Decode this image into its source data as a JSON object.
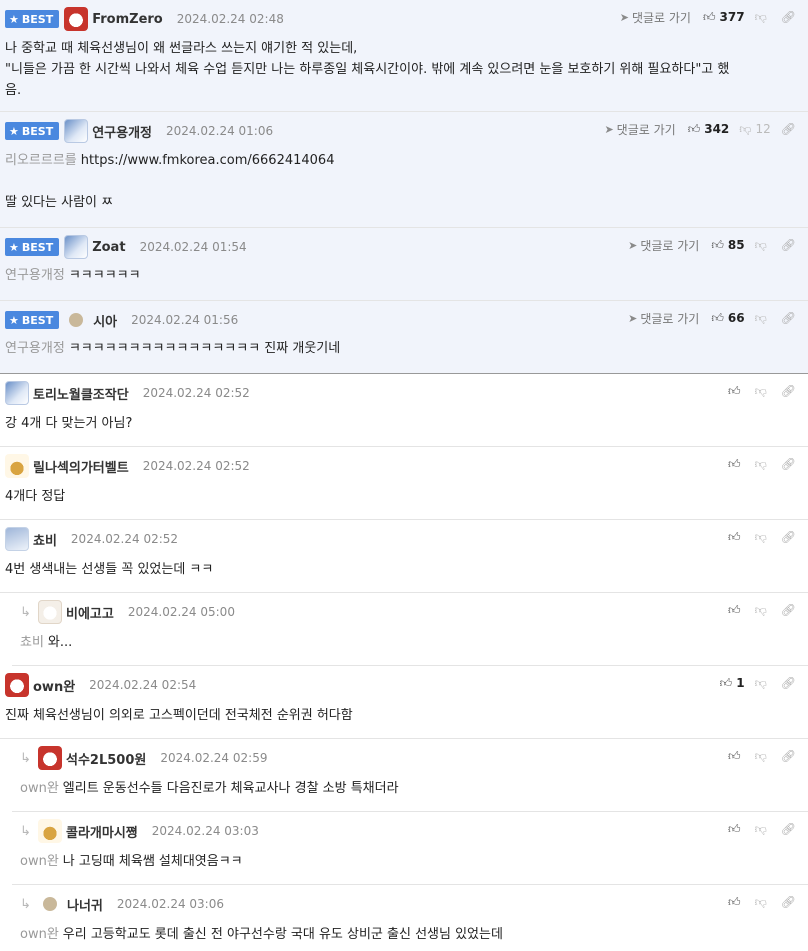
{
  "labels": {
    "best": "BEST",
    "reply_to": "댓글로 가기"
  },
  "comments": [
    {
      "nick": "FromZero",
      "date": "2024.02.24 02:48",
      "best": true,
      "up": "377",
      "down": "",
      "lines": [
        "나 중학교 때 체육선생님이 왜 썬글라스 쓰는지 얘기한 적 있는데,",
        "\"니들은 가끔 한 시간씩 나와서 체육 수업 듣지만 나는 하루종일 체육시간이야. 밖에 계속 있으려면 눈을 보호하기 위해 필요하다\"고 했",
        "음."
      ]
    },
    {
      "nick": "연구용개정",
      "date": "2024.02.24 01:06",
      "best": true,
      "up": "342",
      "down": "12",
      "mention": "리오르르르를",
      "link": "https://www.fmkorea.com/6662414064",
      "line2": "딸 있다는 사람이 ㅉ"
    },
    {
      "nick": "Zoat",
      "date": "2024.02.24 01:54",
      "best": true,
      "up": "85",
      "down": "",
      "mention": "연구용개정",
      "text": "ㅋㅋㅋㅋㅋㅋ"
    },
    {
      "nick": "시아",
      "date": "2024.02.24 01:56",
      "best": true,
      "up": "66",
      "down": "",
      "mention": "연구용개정",
      "text": "ㅋㅋㅋㅋㅋㅋㅋㅋㅋㅋㅋㅋㅋㅋㅋㅋ 진짜 개웃기네"
    },
    {
      "nick": "토리노월클조작단",
      "date": "2024.02.24 02:52",
      "up": "",
      "text": "강 4개 다 맞는거 아님?"
    },
    {
      "nick": "릴나섹의가터벨트",
      "date": "2024.02.24 02:52",
      "up": "",
      "text": "4개다 정답"
    },
    {
      "nick": "쵸비",
      "date": "2024.02.24 02:52",
      "up": "",
      "text": "4번 생색내는 선생들 꼭 있었는데 ㅋㅋ"
    },
    {
      "nick": "비에고고",
      "date": "2024.02.24 05:00",
      "up": "",
      "mention": "쵸비",
      "text": "와..."
    },
    {
      "nick": "own완",
      "date": "2024.02.24 02:54",
      "up": "1",
      "text": "진짜 체육선생님이 의외로 고스펙이던데 전국체전 순위권 허다함"
    },
    {
      "nick": "석수2L500원",
      "date": "2024.02.24 02:59",
      "up": "",
      "mention": "own완",
      "text": "엘리트 운동선수들 다음진로가 체육교사나 경찰 소방 특채더라"
    },
    {
      "nick": "콜라개마시쪙",
      "date": "2024.02.24 03:03",
      "up": "",
      "mention": "own완",
      "text": "나 고딩때 체육쌤 설체대엿음ㅋㅋ"
    },
    {
      "nick": "나너귀",
      "date": "2024.02.24 03:06",
      "up": "",
      "mention": "own완",
      "text": "우리 고등학교도 롯데 출신 전 야구선수랑 국대 유도 상비군 출신 선생님 있었는데"
    }
  ]
}
